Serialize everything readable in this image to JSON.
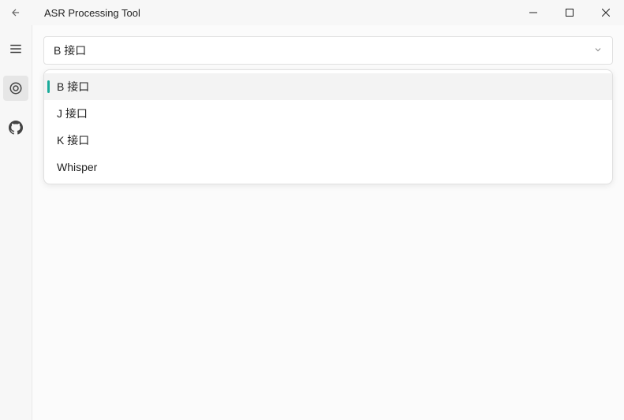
{
  "title": "ASR Processing Tool",
  "dropdown": {
    "selected": "B 接口",
    "options": [
      {
        "label": "B 接口",
        "selected": true
      },
      {
        "label": "J 接口",
        "selected": false
      },
      {
        "label": "K 接口",
        "selected": false
      },
      {
        "label": "Whisper",
        "selected": false
      }
    ]
  }
}
